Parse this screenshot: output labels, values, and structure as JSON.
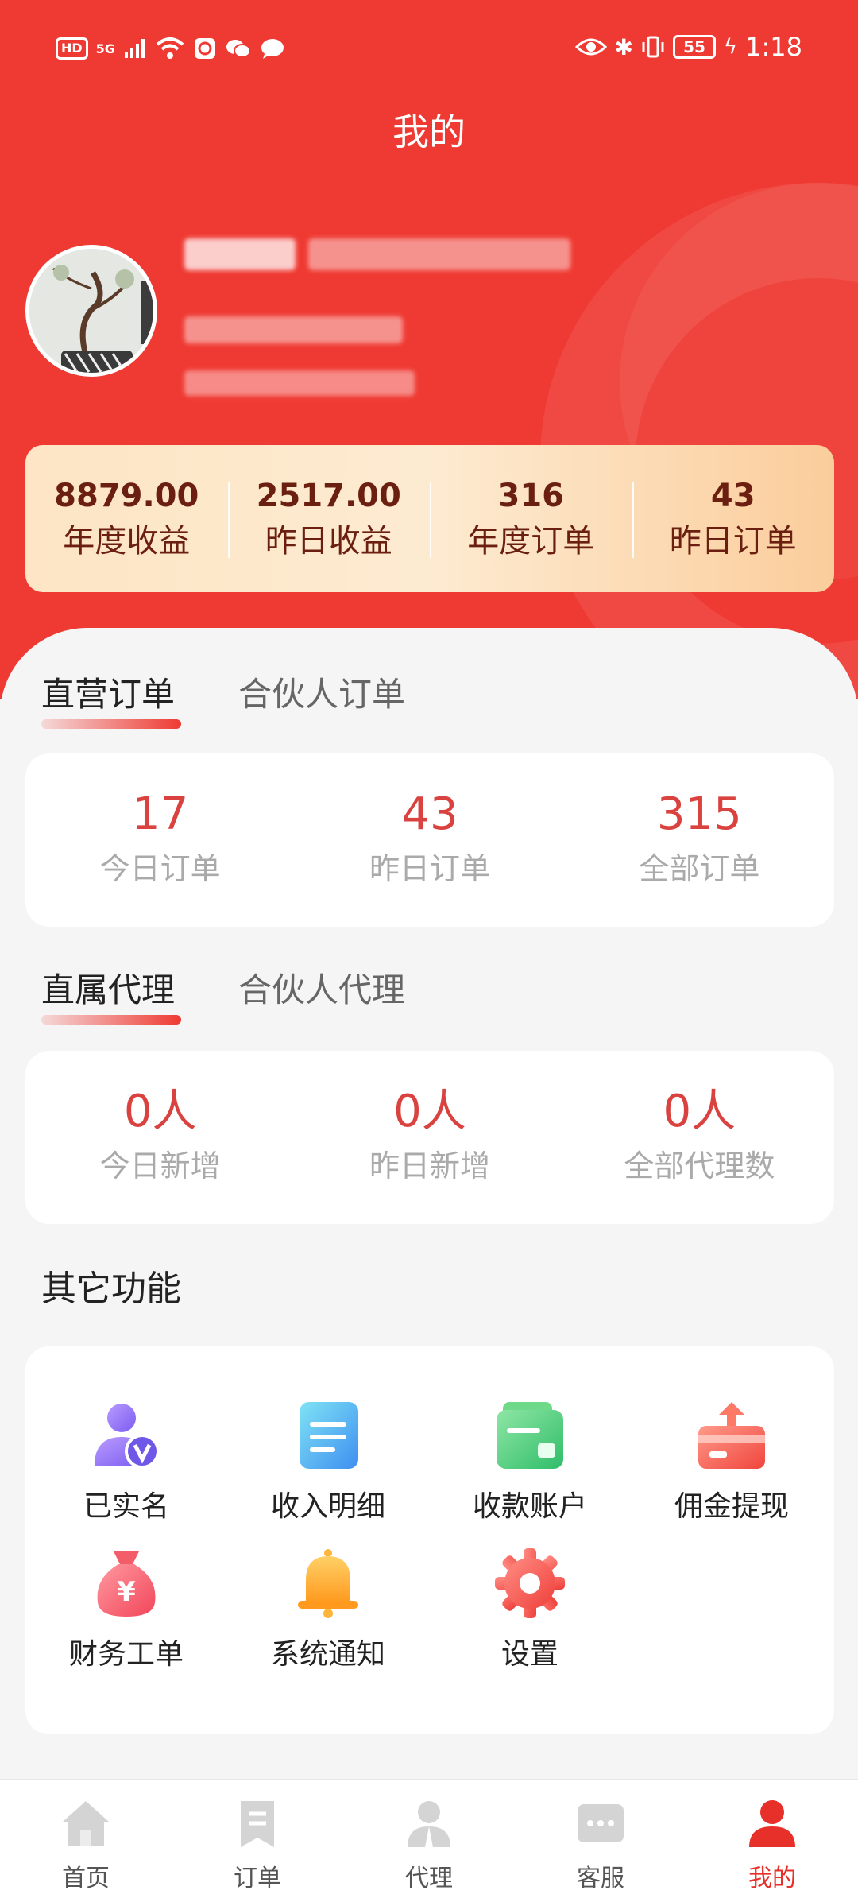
{
  "status_bar": {
    "left_badge": "HD",
    "signal": "5G",
    "battery": "55",
    "time": "1:18"
  },
  "header": {
    "title": "我的"
  },
  "stats": [
    {
      "value": "8879.00",
      "label": "年度收益"
    },
    {
      "value": "2517.00",
      "label": "昨日收益"
    },
    {
      "value": "316",
      "label": "年度订单"
    },
    {
      "value": "43",
      "label": "昨日订单"
    }
  ],
  "orders": {
    "tabs": [
      "直营订单",
      "合伙人订单"
    ],
    "active_tab": 0,
    "metrics": [
      {
        "value": "17",
        "label": "今日订单"
      },
      {
        "value": "43",
        "label": "昨日订单"
      },
      {
        "value": "315",
        "label": "全部订单"
      }
    ]
  },
  "agents": {
    "tabs": [
      "直属代理",
      "合伙人代理"
    ],
    "active_tab": 0,
    "metrics": [
      {
        "value": "0人",
        "label": "今日新增"
      },
      {
        "value": "0人",
        "label": "昨日新增"
      },
      {
        "value": "0人",
        "label": "全部代理数"
      }
    ]
  },
  "other": {
    "title": "其它功能",
    "items": [
      {
        "label": "已实名",
        "icon": "verified-user-icon"
      },
      {
        "label": "收入明细",
        "icon": "income-detail-icon"
      },
      {
        "label": "收款账户",
        "icon": "wallet-icon"
      },
      {
        "label": "佣金提现",
        "icon": "withdraw-icon"
      },
      {
        "label": "财务工单",
        "icon": "money-bag-icon"
      },
      {
        "label": "系统通知",
        "icon": "bell-icon"
      },
      {
        "label": "设置",
        "icon": "gear-icon"
      }
    ]
  },
  "tabbar": {
    "active": 4,
    "items": [
      {
        "label": "首页",
        "icon": "home-icon"
      },
      {
        "label": "订单",
        "icon": "order-icon"
      },
      {
        "label": "代理",
        "icon": "agent-icon"
      },
      {
        "label": "客服",
        "icon": "chat-icon"
      },
      {
        "label": "我的",
        "icon": "profile-icon"
      }
    ]
  },
  "colors": {
    "brand_red": "#ef3a33",
    "metric_red": "#d9423f",
    "stat_text": "#6a1f10"
  }
}
